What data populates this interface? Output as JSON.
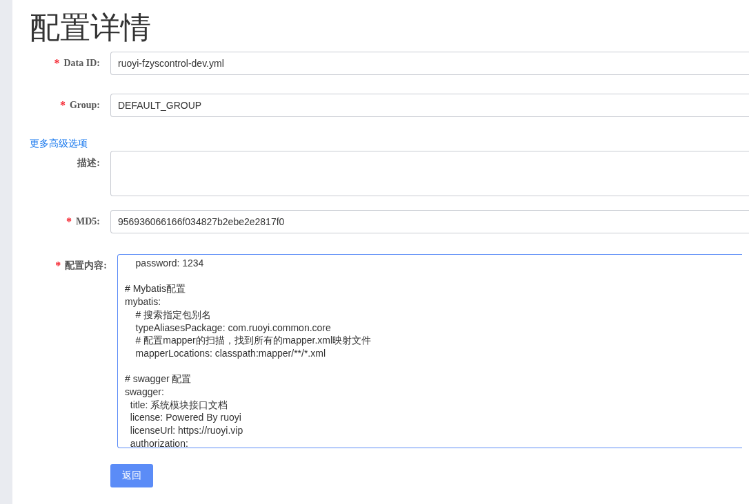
{
  "page": {
    "title": "配置详情"
  },
  "required_mark": "*",
  "fields": [
    {
      "kind": "input",
      "label": "Data ID:",
      "required": true,
      "value": "ruoyi-fzyscontrol-dev.yml"
    },
    {
      "kind": "input",
      "label": "Group:",
      "required": true,
      "value": "DEFAULT_GROUP"
    },
    {
      "kind": "link",
      "text": "更多高级选项"
    },
    {
      "kind": "textarea",
      "label": "描述:",
      "required": false
    },
    {
      "kind": "input",
      "label": "MD5:",
      "required": true,
      "value": "956936066166f034827b2ebe2e2817f0"
    },
    {
      "kind": "code",
      "label": "配置内容:",
      "required": true,
      "focused": true,
      "blocks": [
        [
          "    password: 1234"
        ],
        [
          "# Mybatis配置",
          "mybatis:",
          "    # 搜索指定包别名",
          "    typeAliasesPackage: com.ruoyi.common.core",
          "    # 配置mapper的扫描，找到所有的mapper.xml映射文件",
          "    mapperLocations: classpath:mapper/**/*.xml"
        ],
        [
          "# swagger 配置",
          "swagger:",
          "  title: 系统模块接口文档",
          "  license: Powered By ruoyi",
          "  licenseUrl: https://ruoyi.vip",
          "  authorization:"
        ]
      ]
    }
  ],
  "buttons": [
    {
      "label": "返回"
    }
  ]
}
